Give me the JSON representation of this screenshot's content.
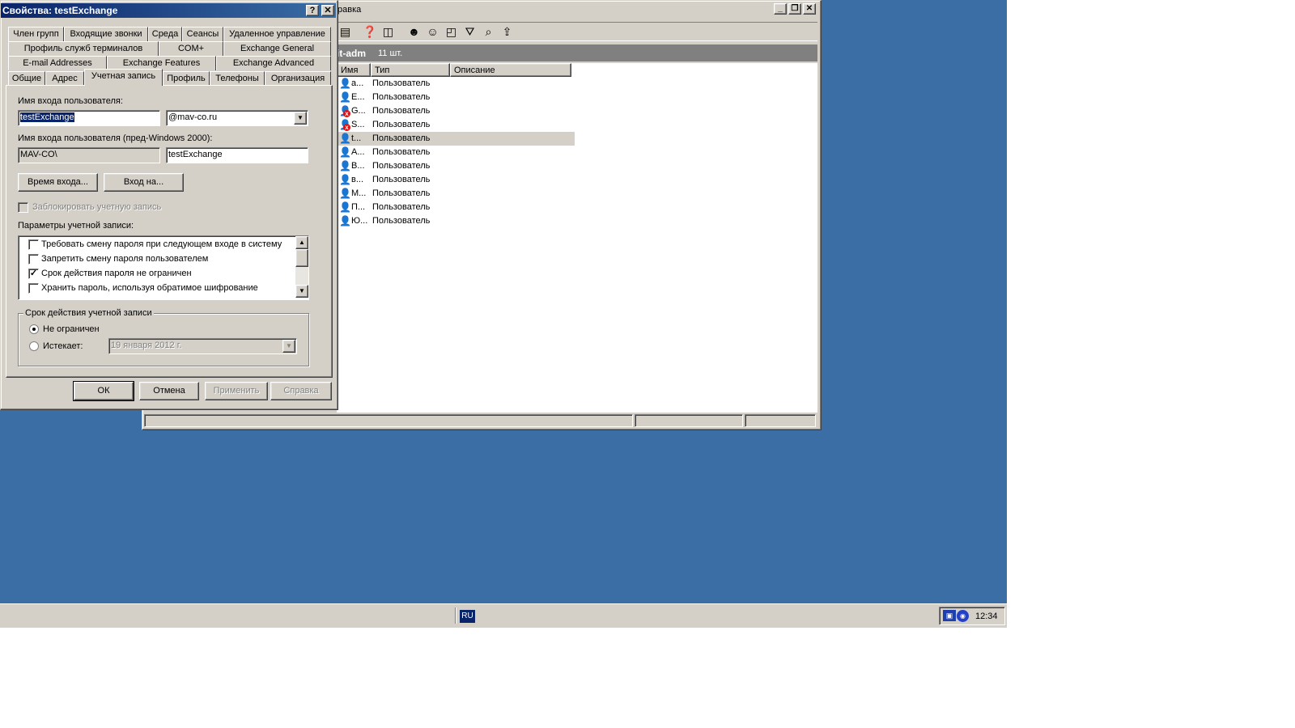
{
  "mmc": {
    "menu_partial": "равка",
    "header_title": "it-adm",
    "header_count": "11 шт.",
    "columns": [
      "Имя",
      "Тип",
      "Описание"
    ],
    "rows": [
      {
        "name": "a...",
        "type": "Пользователь",
        "disabled": false,
        "selected": false
      },
      {
        "name": "E...",
        "type": "Пользователь",
        "disabled": false,
        "selected": false
      },
      {
        "name": "G...",
        "type": "Пользователь",
        "disabled": true,
        "selected": false
      },
      {
        "name": "S...",
        "type": "Пользователь",
        "disabled": true,
        "selected": false
      },
      {
        "name": "t...",
        "type": "Пользователь",
        "disabled": false,
        "selected": true
      },
      {
        "name": "A...",
        "type": "Пользователь",
        "disabled": false,
        "selected": false
      },
      {
        "name": "B...",
        "type": "Пользователь",
        "disabled": false,
        "selected": false
      },
      {
        "name": "в...",
        "type": "Пользователь",
        "disabled": false,
        "selected": false
      },
      {
        "name": "M...",
        "type": "Пользователь",
        "disabled": false,
        "selected": false
      },
      {
        "name": "П...",
        "type": "Пользователь",
        "disabled": false,
        "selected": false
      },
      {
        "name": "Ю...",
        "type": "Пользователь",
        "disabled": false,
        "selected": false
      }
    ]
  },
  "dialog": {
    "title": "Свойства: testExchange",
    "help_btn": "?",
    "close_btn": "✕",
    "tabs_row1": [
      "Член групп",
      "Входящие звонки",
      "Среда",
      "Сеансы",
      "Удаленное управление"
    ],
    "tabs_row2": [
      "Профиль служб терминалов",
      "COM+",
      "Exchange General"
    ],
    "tabs_row3": [
      "E-mail Addresses",
      "Exchange Features",
      "Exchange Advanced"
    ],
    "tabs_row4": [
      "Общие",
      "Адрес",
      "Учетная запись",
      "Профиль",
      "Телефоны",
      "Организация"
    ],
    "logon_name_label": "Имя входа пользователя:",
    "logon_name_value": "testExchange",
    "upn_suffix": "@mav-co.ru",
    "prewin_label": "Имя входа пользователя (пред-Windows 2000):",
    "prewin_domain": "MAV-CO\\",
    "prewin_name": "testExchange",
    "logon_hours_btn": "Время входа...",
    "logon_to_btn": "Вход на...",
    "lock_account_label": "Заблокировать учетную запись",
    "account_options_label": "Параметры учетной записи:",
    "options": [
      {
        "label": "Требовать смену пароля при следующем входе в систему",
        "checked": false
      },
      {
        "label": "Запретить смену пароля пользователем",
        "checked": false
      },
      {
        "label": "Срок действия пароля не ограничен",
        "checked": true
      },
      {
        "label": "Хранить пароль, используя обратимое шифрование",
        "checked": false
      }
    ],
    "expires_group_label": "Срок действия учетной записи",
    "never_label": "Не ограничен",
    "end_of_label": "Истекает:",
    "expires_date": "19   января   2012 г.",
    "ok_btn": "ОК",
    "cancel_btn": "Отмена",
    "apply_btn": "Применить",
    "help_bottom_btn": "Справка"
  },
  "taskbar": {
    "lang": "RU",
    "clock": "12:34"
  }
}
